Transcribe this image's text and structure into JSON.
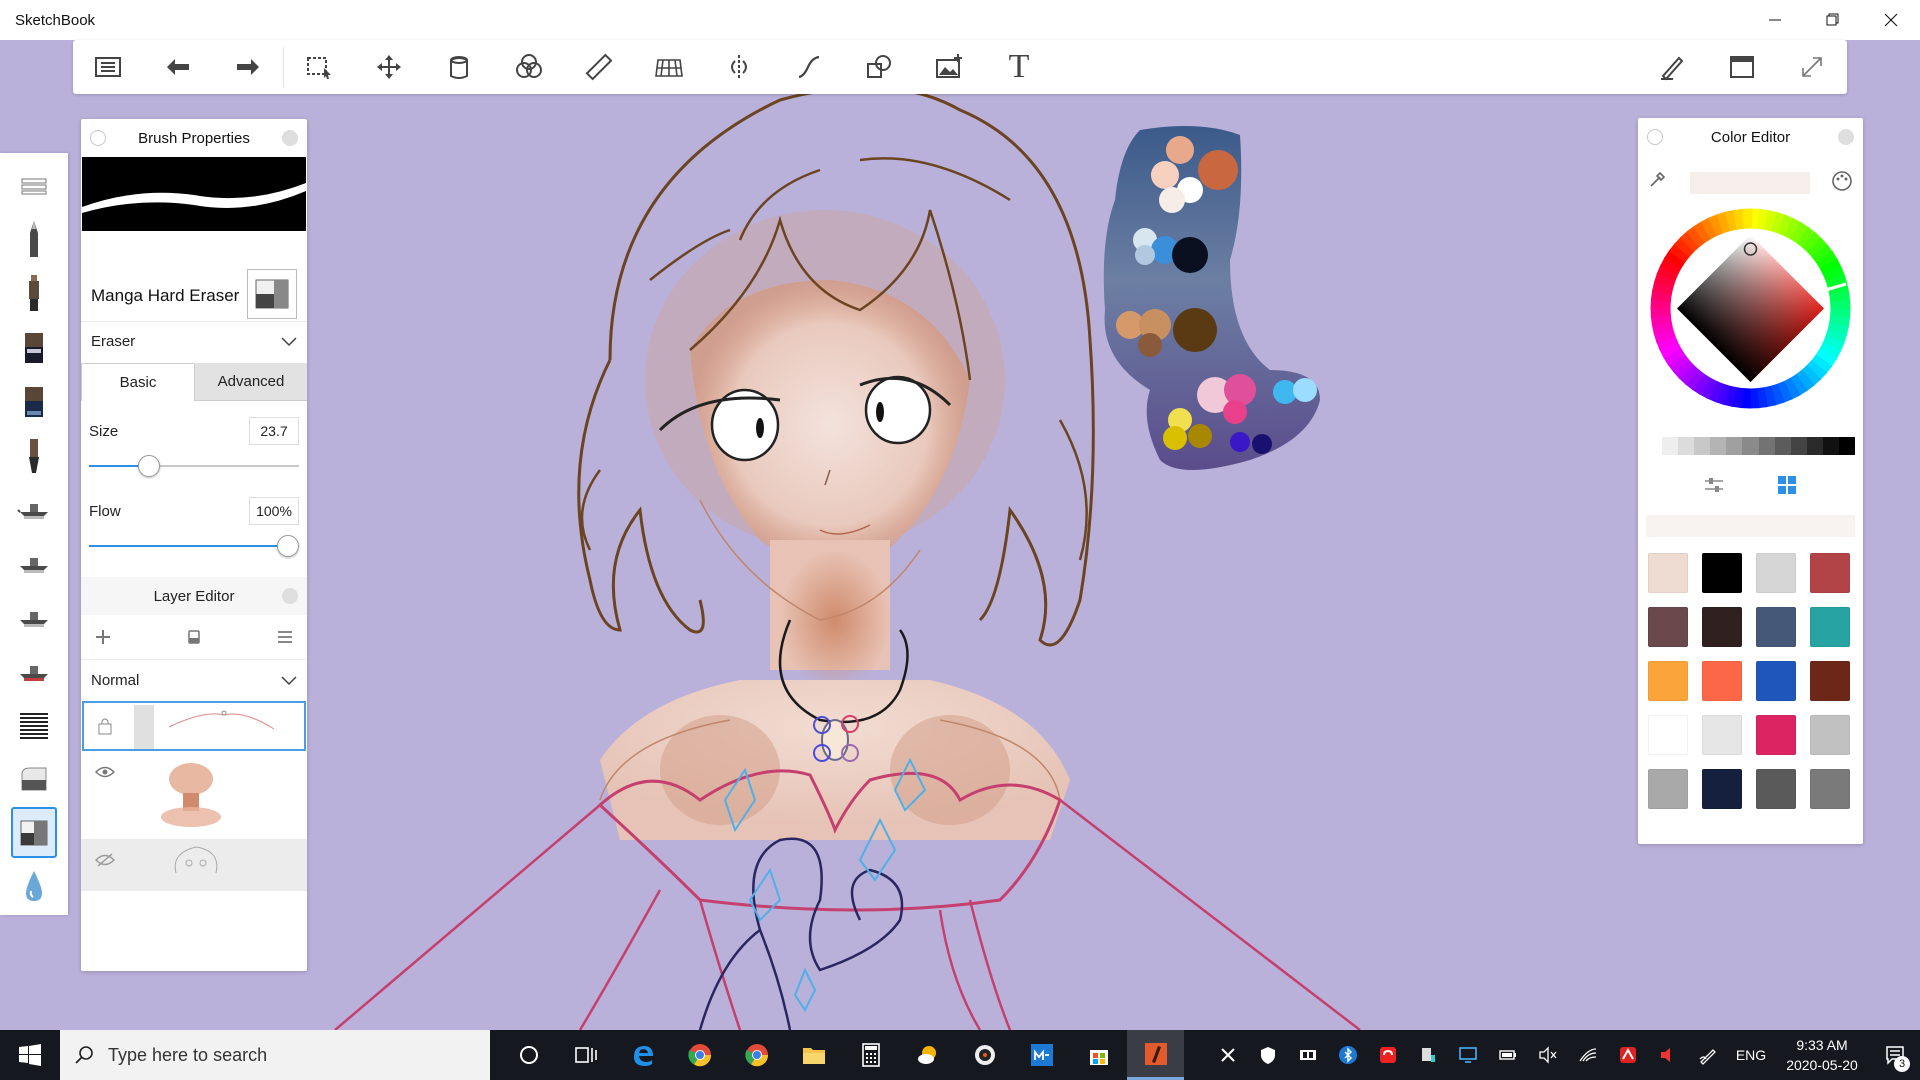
{
  "window": {
    "title": "SketchBook"
  },
  "toolbar": {
    "left_tools": [
      "menu-icon",
      "undo-icon",
      "redo-icon"
    ],
    "canvas_tools": [
      "selection-icon",
      "transform-icon",
      "fill-icon",
      "color-mix-icon",
      "ruler-icon",
      "perspective-icon",
      "symmetry-icon",
      "stroke-icon",
      "shapes-icon",
      "add-image-icon",
      "text-icon"
    ],
    "text_tool_label": "T",
    "right_tools": [
      "brush-library-icon",
      "fullscreen-window-icon",
      "expand-icon"
    ]
  },
  "brush_panel": {
    "title": "Brush Properties",
    "brush_name": "Manga Hard Eraser",
    "brush_type": "Eraser",
    "tabs": [
      {
        "label": "Basic",
        "active": true
      },
      {
        "label": "Advanced",
        "active": false
      }
    ],
    "size": {
      "label": "Size",
      "value": "23.7",
      "fraction": 0.26
    },
    "flow": {
      "label": "Flow",
      "value": "100%",
      "fraction": 1.0
    }
  },
  "layer_editor": {
    "title": "Layer Editor",
    "blend_mode": "Normal",
    "layers": [
      {
        "visible": true,
        "locked": true,
        "selected": true
      },
      {
        "visible": true,
        "selected": false
      },
      {
        "visible": false,
        "selected": false
      }
    ]
  },
  "color_editor": {
    "title": "Color Editor",
    "current_color": "#f6eeea",
    "grays": [
      "#ffffff",
      "#eeeeee",
      "#dcdcdc",
      "#c8c8c8",
      "#b4b4b4",
      "#a0a0a0",
      "#8a8a8a",
      "#737373",
      "#5c5c5c",
      "#444444",
      "#2a2a2a",
      "#111111",
      "#000000"
    ],
    "swatches": [
      "#eedcd3",
      "#000000",
      "#d6d6d6",
      "#b24448",
      "#6a484c",
      "#302020",
      "#465878",
      "#28a3a3",
      "#fba43a",
      "#fc6747",
      "#1f56bc",
      "#6d2718",
      "#ffffff",
      "#e6e6e6",
      "#dd2462",
      "#c1c1c1",
      "#a9a9a9",
      "#15203f",
      "#5a5a5a",
      "#7a7a7a"
    ]
  },
  "taskbar": {
    "search_placeholder": "Type here to search",
    "apps": [
      "cortana-icon",
      "task-view-icon",
      "edge-icon",
      "chrome-icon",
      "chrome-icon",
      "file-explorer-icon",
      "calculator-icon",
      "weather-icon",
      "media-player-icon",
      "mail-icon",
      "store-icon",
      "sketchbook-icon"
    ],
    "language": "ENG",
    "time": "9:33 AM",
    "date": "2020-05-20",
    "notifications": "3"
  },
  "colors": {
    "canvas_bg": "#b9b1da",
    "accent": "#2d8fe6",
    "taskbar_bg": "#16181f"
  }
}
